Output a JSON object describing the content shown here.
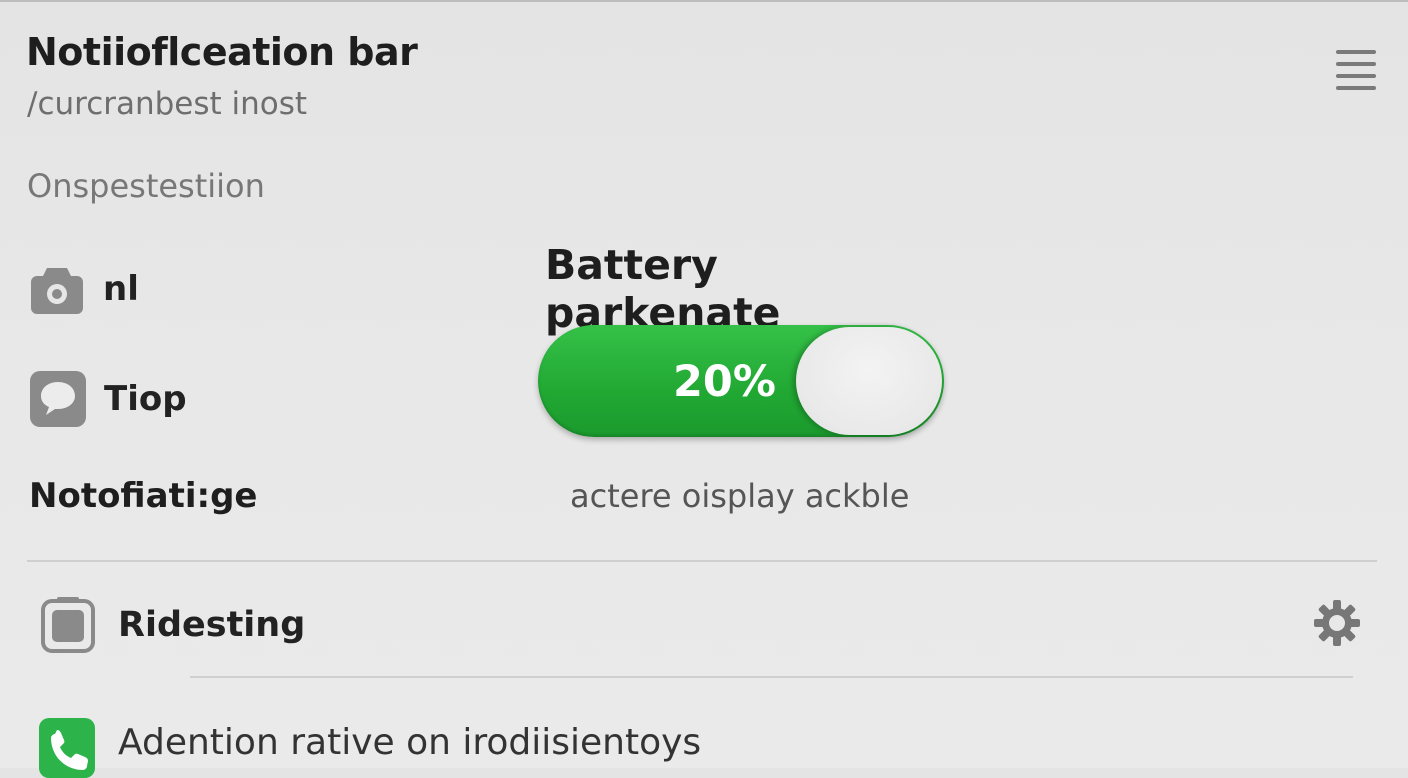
{
  "header": {
    "title": "Notiioflceation bar",
    "subtitle": "/curcranbest inost"
  },
  "section": {
    "label": "Onspestestiion"
  },
  "items": [
    {
      "label": "nl",
      "icon": "camera-icon"
    },
    {
      "label": "Tiop",
      "icon": "message-icon"
    }
  ],
  "notification": {
    "title": "Notofiati:ge"
  },
  "battery": {
    "title": "Battery parkenate",
    "toggle_label": "20%",
    "toggle_on": true,
    "caption": "actere oisplay ackble"
  },
  "settings": {
    "row_label": "Ridesting",
    "row_icon": "battery-icon",
    "gear_icon": "gear-icon"
  },
  "footer": {
    "text": "Adention rative on irodiisientoys",
    "icon": "phone-icon"
  },
  "colors": {
    "accent_green": "#22a935",
    "background": "#e6e6e6"
  }
}
